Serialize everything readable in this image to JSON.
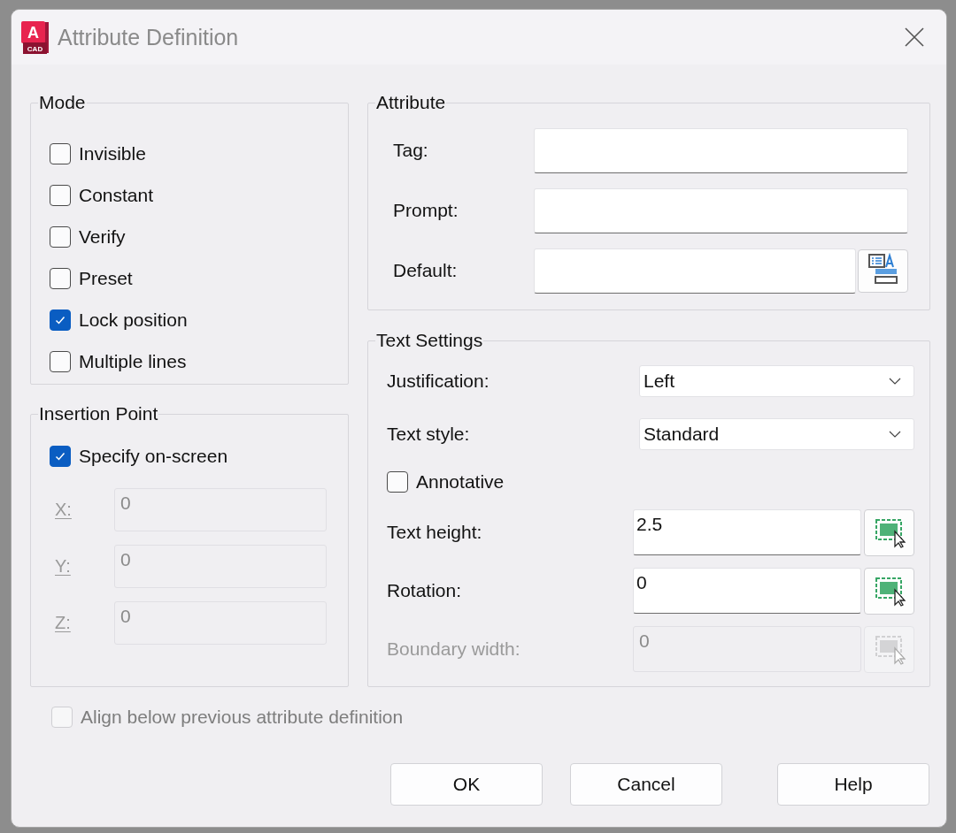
{
  "window": {
    "title": "Attribute Definition",
    "app_icon": {
      "letter": "A",
      "caption": "CAD"
    }
  },
  "mode": {
    "title": "Mode",
    "options": [
      {
        "label": "Invisible",
        "checked": false
      },
      {
        "label": "Constant",
        "checked": false
      },
      {
        "label": "Verify",
        "checked": false
      },
      {
        "label": "Preset",
        "checked": false
      },
      {
        "label": "Lock position",
        "checked": true
      },
      {
        "label": "Multiple lines",
        "checked": false
      }
    ]
  },
  "insertion_point": {
    "title": "Insertion Point",
    "specify_on_screen": {
      "label": "Specify on-screen",
      "checked": true
    },
    "coordinates": [
      {
        "label": "X:",
        "value": "0",
        "disabled": true
      },
      {
        "label": "Y:",
        "value": "0",
        "disabled": true
      },
      {
        "label": "Z:",
        "value": "0",
        "disabled": true
      }
    ]
  },
  "attribute": {
    "title": "Attribute",
    "fields": [
      {
        "label": "Tag:",
        "kind": "text"
      },
      {
        "label": "Prompt:",
        "kind": "text"
      },
      {
        "label": "Default:",
        "kind": "field-button"
      }
    ]
  },
  "text_settings": {
    "title": "Text Settings",
    "rows": [
      {
        "kind": "dropdown",
        "label": "Justification:",
        "value": "Left"
      },
      {
        "kind": "dropdown",
        "label": "Text style:",
        "value": "Standard"
      },
      {
        "kind": "checkbox",
        "label": "Annotative",
        "checked": false
      },
      {
        "kind": "pick",
        "label": "Text height:",
        "value": "2.5",
        "disabled": false
      },
      {
        "kind": "pick",
        "label": "Rotation:",
        "value": "0",
        "disabled": false
      },
      {
        "kind": "pick",
        "label": "Boundary width:",
        "value": "0",
        "disabled": true
      }
    ]
  },
  "align_below": {
    "label": "Align below previous attribute definition",
    "checked": false,
    "disabled": true
  },
  "buttons": [
    "OK",
    "Cancel",
    "Help"
  ]
}
